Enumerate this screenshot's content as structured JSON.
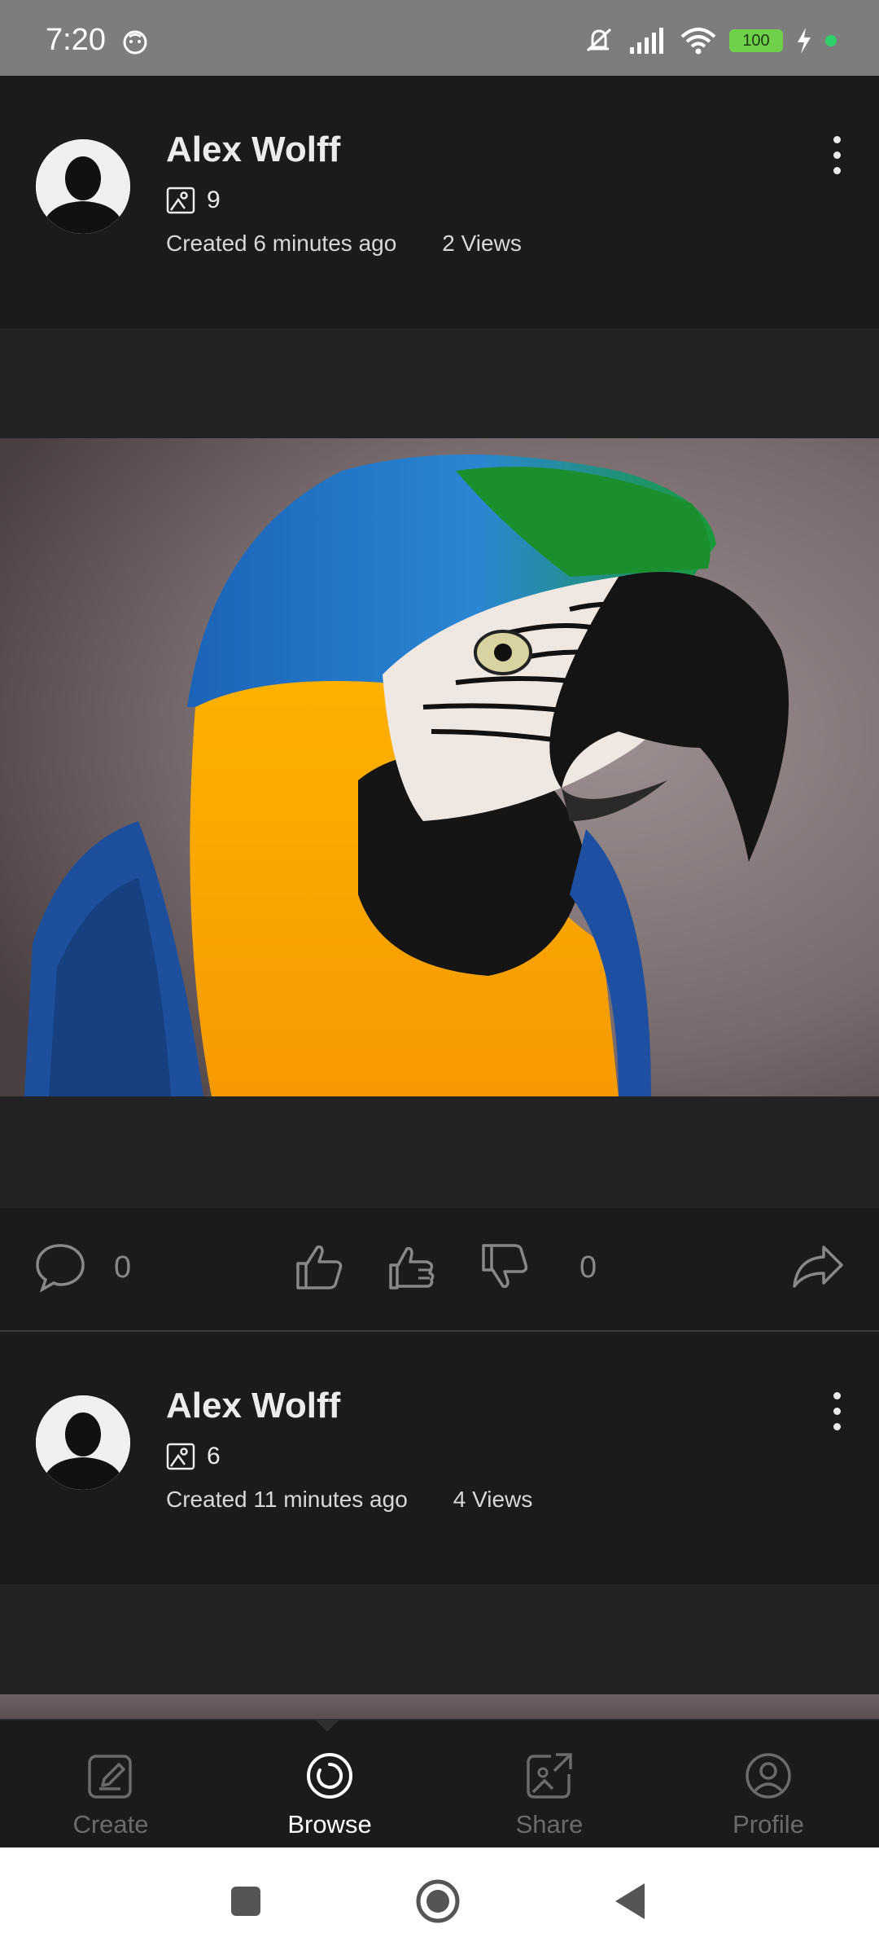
{
  "status_bar": {
    "time": "7:20",
    "battery": "100",
    "icons": [
      "silent-icon",
      "signal-icon",
      "wifi-icon",
      "battery-icon",
      "charging-icon"
    ]
  },
  "posts": [
    {
      "author": "Alex Wolff",
      "image_count": "9",
      "created": "Created 6 minutes ago",
      "views": "2 Views",
      "image": "blue-and-yellow macaw parrot",
      "comments": "0",
      "votes": "0"
    },
    {
      "author": "Alex Wolff",
      "image_count": "6",
      "created": "Created 11 minutes ago",
      "views": "4 Views"
    }
  ],
  "bottom_nav": {
    "items": [
      {
        "label": "Create",
        "icon": "create-icon",
        "active": false
      },
      {
        "label": "Browse",
        "icon": "browse-icon",
        "active": true
      },
      {
        "label": "Share",
        "icon": "share-icon",
        "active": false
      },
      {
        "label": "Profile",
        "icon": "profile-icon",
        "active": false
      }
    ]
  },
  "colors": {
    "background": "#1b1b1d",
    "status_bar": "#7d7d7d",
    "battery": "#6fd14a",
    "active_nav": "#ffffff",
    "inactive_nav": "#6b6b6b"
  }
}
